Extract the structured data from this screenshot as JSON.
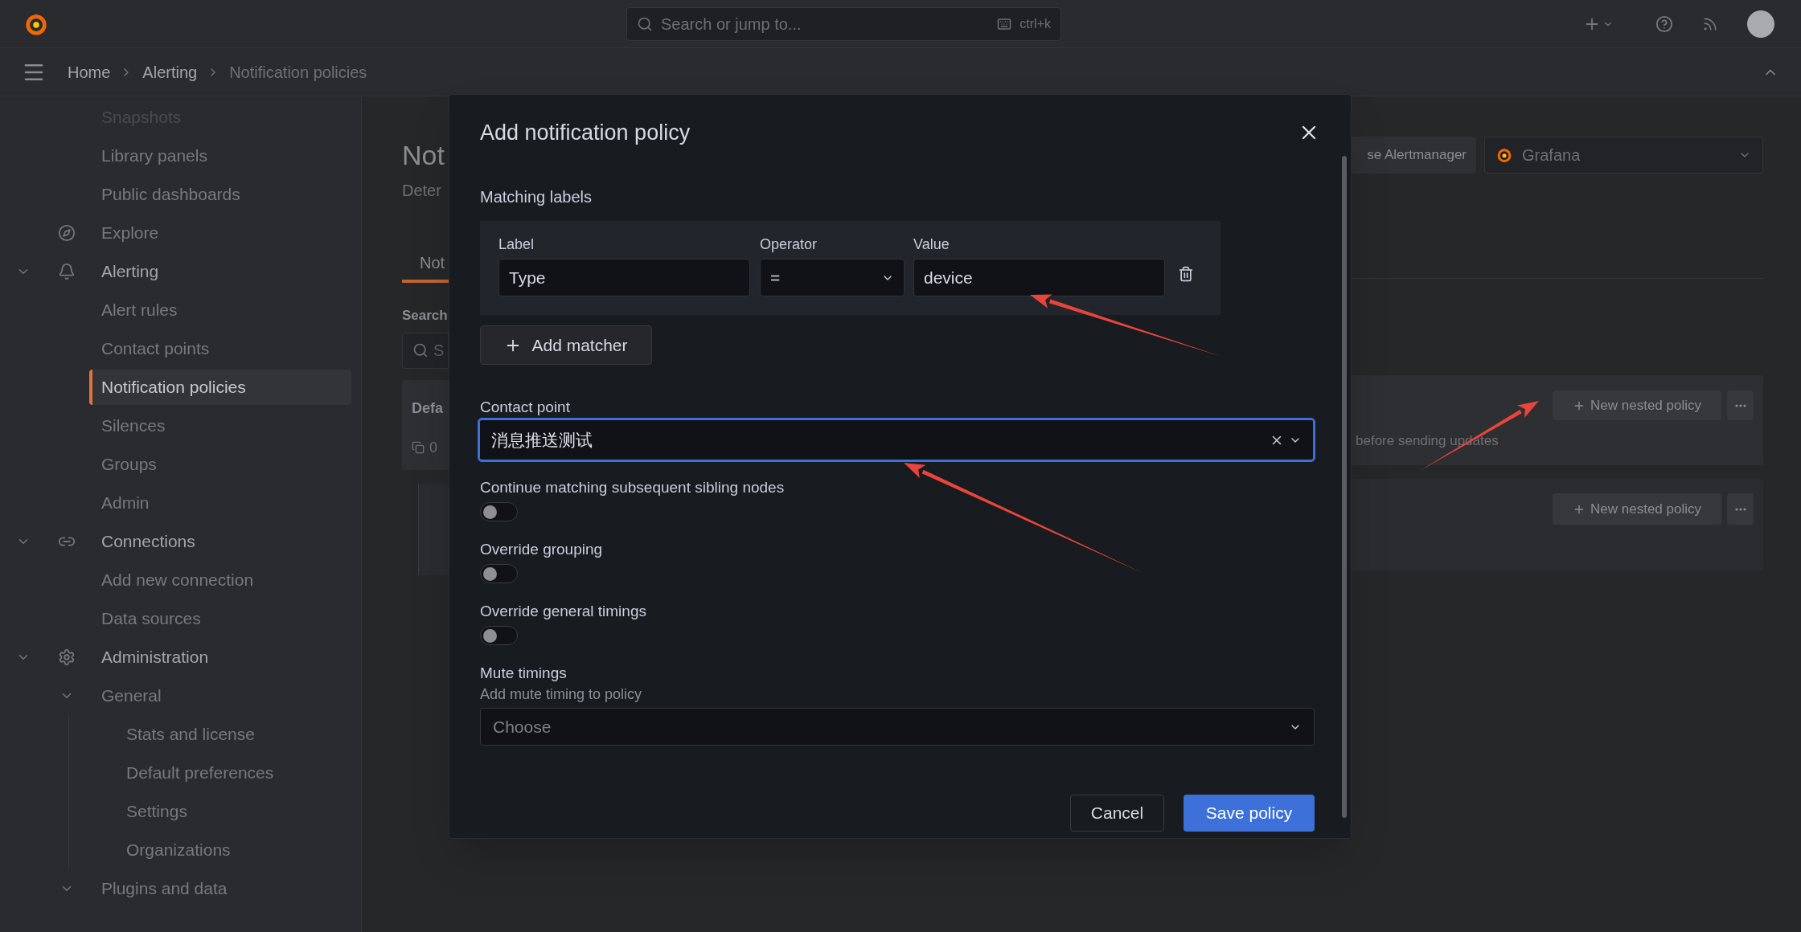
{
  "top_bar": {
    "search": {
      "placeholder": "Search or jump to...",
      "shortcut": "ctrl+k"
    }
  },
  "breadcrumbs": [
    {
      "label": "Home",
      "current": false
    },
    {
      "label": "Alerting",
      "current": false
    },
    {
      "label": "Notification policies",
      "current": true
    }
  ],
  "sidebar": {
    "scrolled_items": [
      {
        "label": "Snapshots",
        "selected": false
      },
      {
        "label": "Library panels",
        "selected": false
      },
      {
        "label": "Public dashboards",
        "selected": false
      }
    ],
    "items": [
      {
        "label": "Explore",
        "selected": false
      },
      {
        "label": "Alerting",
        "selected": false,
        "expanded": true,
        "children": [
          {
            "label": "Alert rules",
            "selected": false
          },
          {
            "label": "Contact points",
            "selected": false
          },
          {
            "label": "Notification policies",
            "selected": true
          },
          {
            "label": "Silences",
            "selected": false
          },
          {
            "label": "Groups",
            "selected": false
          },
          {
            "label": "Admin",
            "selected": false
          }
        ]
      },
      {
        "label": "Connections",
        "selected": false,
        "expanded": true,
        "children": [
          {
            "label": "Add new connection",
            "selected": false
          },
          {
            "label": "Data sources",
            "selected": false
          }
        ]
      },
      {
        "label": "Administration",
        "selected": false,
        "expanded": true,
        "children": [
          {
            "label": "General",
            "selected": false,
            "expanded": true,
            "children": [
              {
                "label": "Stats and license",
                "selected": false
              },
              {
                "label": "Default preferences",
                "selected": false
              },
              {
                "label": "Settings",
                "selected": false
              },
              {
                "label": "Organizations",
                "selected": false
              }
            ]
          },
          {
            "label": "Plugins and data",
            "selected": false,
            "expanded": true
          }
        ]
      }
    ]
  },
  "page": {
    "title": "Not",
    "subtitle": "Deter",
    "tabs": [
      {
        "label": "Not",
        "selected": true
      }
    ],
    "search_label": "Search",
    "search_placeholder": "S",
    "alertmanager_button": "se Alertmanager",
    "alertmanager_select": "Grafana",
    "default_policy": {
      "name": "Defa",
      "count": "0",
      "note": "before sending updates",
      "button": "New nested policy"
    },
    "nested_policy": {
      "button": "New nested policy"
    }
  },
  "modal": {
    "title": "Add notification policy",
    "matching_labels": {
      "title": "Matching labels",
      "columns": [
        "Label",
        "Operator",
        "Value"
      ],
      "matchers": [
        {
          "label": "Type",
          "operator": "=",
          "value": "device"
        }
      ]
    },
    "add_matcher": "Add matcher",
    "contact_point": {
      "label": "Contact point",
      "value": "消息推送测试",
      "focused": true
    },
    "toggles": [
      {
        "label": "Continue matching subsequent sibling nodes",
        "on": false
      },
      {
        "label": "Override grouping",
        "on": false
      },
      {
        "label": "Override general timings",
        "on": false
      }
    ],
    "mute_timings": {
      "label": "Mute timings",
      "description": "Add mute timing to policy",
      "placeholder": "Choose"
    },
    "buttons": [
      {
        "label": "Cancel",
        "kind": "secondary"
      },
      {
        "label": "Save policy",
        "kind": "primary"
      }
    ]
  }
}
